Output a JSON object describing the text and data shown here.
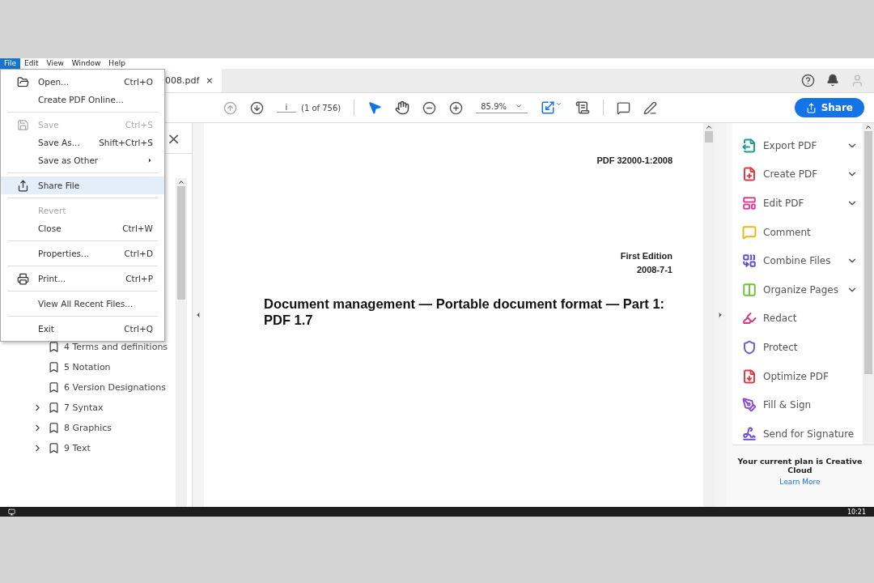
{
  "menubar": [
    {
      "label": "File",
      "selected": true
    },
    {
      "label": "Edit",
      "selected": false
    },
    {
      "label": "View",
      "selected": false
    },
    {
      "label": "Window",
      "selected": false
    },
    {
      "label": "Help",
      "selected": false
    }
  ],
  "file_menu": [
    {
      "kind": "item",
      "label": "Open...",
      "shortcut": "Ctrl+O",
      "disabled": false,
      "selected": false
    },
    {
      "kind": "item",
      "label": "Create PDF Online...",
      "disabled": false,
      "selected": false
    },
    {
      "kind": "separator"
    },
    {
      "kind": "item",
      "label": "Save",
      "shortcut": "Ctrl+S",
      "disabled": true,
      "selected": false
    },
    {
      "kind": "item",
      "label": "Save As...",
      "shortcut": "Shift+Ctrl+S",
      "disabled": false,
      "selected": false
    },
    {
      "kind": "submenu",
      "label": "Save as Other",
      "disabled": false,
      "selected": false
    },
    {
      "kind": "separator"
    },
    {
      "kind": "item",
      "label": "Share File",
      "disabled": false,
      "selected": true
    },
    {
      "kind": "separator"
    },
    {
      "kind": "item",
      "label": "Revert",
      "disabled": true,
      "selected": false
    },
    {
      "kind": "item",
      "label": "Close",
      "shortcut": "Ctrl+W",
      "disabled": false,
      "selected": false
    },
    {
      "kind": "separator"
    },
    {
      "kind": "item",
      "label": "Properties...",
      "shortcut": "Ctrl+D",
      "disabled": false,
      "selected": false
    },
    {
      "kind": "separator"
    },
    {
      "kind": "item",
      "label": "Print...",
      "shortcut": "Ctrl+P",
      "disabled": false,
      "selected": false
    },
    {
      "kind": "separator"
    },
    {
      "kind": "item",
      "label": "View All Recent Files...",
      "disabled": false,
      "selected": false
    },
    {
      "kind": "separator"
    },
    {
      "kind": "item",
      "label": "Exit",
      "shortcut": "Ctrl+Q",
      "disabled": false,
      "selected": false
    }
  ],
  "document_tab": {
    "title": "008.pdf",
    "close": "×"
  },
  "toolbar": {
    "page_field": "i",
    "page_count": "(1 of 756)",
    "zoom": "85.9%",
    "share_button": "Share",
    "tools": [
      {
        "kind": "select",
        "selected": true
      },
      {
        "kind": "hand",
        "selected": false
      }
    ]
  },
  "bookmarks": {
    "close": "×",
    "items": [
      {
        "label": "4 Terms and definitions",
        "expandable": false
      },
      {
        "label": "5 Notation",
        "expandable": false
      },
      {
        "label": "6 Version Designations",
        "expandable": false
      },
      {
        "label": "7 Syntax",
        "expandable": true
      },
      {
        "label": "8 Graphics",
        "expandable": true
      },
      {
        "label": "9 Text",
        "expandable": true
      }
    ]
  },
  "page": {
    "standard": "PDF 32000-1:2008",
    "edition": "First Edition",
    "date": "2008-7-1",
    "title": "Document management — Portable document format — Part 1: PDF 1.7"
  },
  "tools_panel": {
    "items": [
      {
        "label": "Export PDF",
        "expandable": true,
        "color": "#1b9e8c"
      },
      {
        "label": "Create PDF",
        "expandable": true,
        "color": "#e03a44"
      },
      {
        "label": "Edit PDF",
        "expandable": true,
        "color": "#d9409b"
      },
      {
        "label": "Comment",
        "expandable": false,
        "color": "#e8b912"
      },
      {
        "label": "Combine Files",
        "expandable": true,
        "color": "#5b4fd1"
      },
      {
        "label": "Organize Pages",
        "expandable": true,
        "color": "#6fc23b"
      },
      {
        "label": "Redact",
        "expandable": false,
        "color": "#e0357a"
      },
      {
        "label": "Protect",
        "expandable": false,
        "color": "#6a5fd6"
      },
      {
        "label": "Optimize PDF",
        "expandable": false,
        "color": "#e03a44"
      },
      {
        "label": "Fill & Sign",
        "expandable": false,
        "color": "#8a4fd6"
      },
      {
        "label": "Send for Signature",
        "expandable": false,
        "color": "#6a4fd6"
      }
    ],
    "plan": "Your current plan is Creative Cloud",
    "learn_more": "Learn More"
  },
  "taskbar": {
    "time": "10:21"
  }
}
